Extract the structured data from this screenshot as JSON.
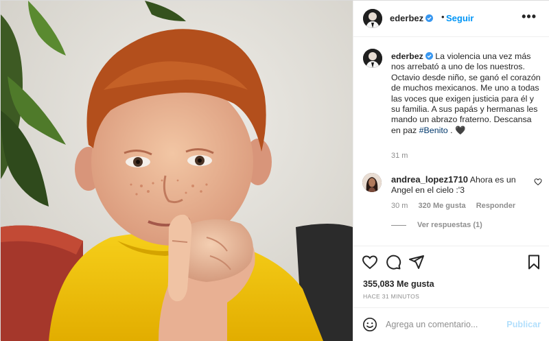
{
  "post": {
    "username": "ederbez",
    "follow_label": "Seguir",
    "more_label": "•••",
    "dot": "•",
    "verified_icon": "verified-badge-icon"
  },
  "caption": {
    "username": "ederbez",
    "text": "La violencia una vez más nos arrebató a uno de los nuestros. Octavio desde niño, se ganó el corazón de muchos mexicanos. Me uno a todas las voces que exigen justicia para él y su familia. A sus papás y hermanas les mando un abrazo fraterno. Descansa en paz",
    "hashtag": "#Benito",
    "tail": " . 🖤",
    "time": "31 m"
  },
  "comment": {
    "username": "andrea_lopez1710",
    "text": "Ahora es un Angel en el cielo :'3",
    "time": "30 m",
    "likes": "320 Me gusta",
    "reply": "Responder",
    "view_replies": "Ver respuestas (1)"
  },
  "actions": {
    "like_count": "355,083 Me gusta",
    "time_ago": "HACE 31 MINUTOS",
    "icons": [
      "heart-icon",
      "comment-icon",
      "share-icon",
      "bookmark-icon"
    ]
  },
  "add_comment": {
    "placeholder": "Agrega un comentario...",
    "publish_label": "Publicar"
  },
  "colors": {
    "accent": "#0095f6",
    "publish_disabled": "#b2dffc",
    "muted": "#8e8e8e",
    "text": "#262626",
    "shirt": "#f2c200",
    "hair": "#b3521f"
  }
}
